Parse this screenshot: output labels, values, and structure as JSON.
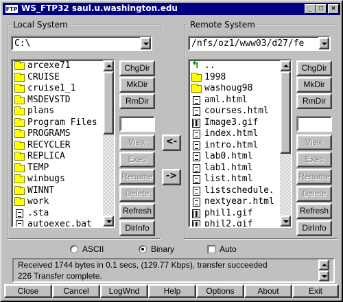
{
  "window": {
    "app_icon_text": "FTP",
    "title": "WS_FTP32 saul.u.washington.edu"
  },
  "local": {
    "group_title": "Local System",
    "path": "C:\\",
    "items": [
      {
        "name": "arcexe71",
        "type": "folder"
      },
      {
        "name": "CRUISE",
        "type": "folder"
      },
      {
        "name": "cruise1_1",
        "type": "folder"
      },
      {
        "name": "MSDEVSTD",
        "type": "folder"
      },
      {
        "name": "plans",
        "type": "folder"
      },
      {
        "name": "Program Files",
        "type": "folder"
      },
      {
        "name": "PROGRAMS",
        "type": "folder"
      },
      {
        "name": "RECYCLER",
        "type": "folder"
      },
      {
        "name": "REPLICA",
        "type": "folder"
      },
      {
        "name": "TEMP",
        "type": "folder"
      },
      {
        "name": "winbugs",
        "type": "folder"
      },
      {
        "name": "WINNT",
        "type": "folder"
      },
      {
        "name": "work",
        "type": "folder"
      },
      {
        "name": ".sta",
        "type": "file"
      },
      {
        "name": "autoexec.bat",
        "type": "file"
      }
    ],
    "buttons": {
      "chgdir": "ChgDir",
      "mkdir": "MkDir",
      "rmdir": "RmDir",
      "view": "View",
      "exec": "Exec",
      "rename": "Rename",
      "delete": "Delete",
      "refresh": "Refresh",
      "dirinfo": "DirInfo"
    }
  },
  "remote": {
    "group_title": "Remote System",
    "path": "/nfs/oz1/www03/d27/fe",
    "items": [
      {
        "name": "..",
        "type": "up"
      },
      {
        "name": "1998",
        "type": "folder"
      },
      {
        "name": "washoug98",
        "type": "folder"
      },
      {
        "name": "aml.html",
        "type": "file"
      },
      {
        "name": "courses.html",
        "type": "file"
      },
      {
        "name": "Image3.gif",
        "type": "image"
      },
      {
        "name": "index.html",
        "type": "file"
      },
      {
        "name": "intro.html",
        "type": "file"
      },
      {
        "name": "lab0.html",
        "type": "file"
      },
      {
        "name": "lab1.html",
        "type": "file"
      },
      {
        "name": "list.html",
        "type": "file"
      },
      {
        "name": "listschedule.",
        "type": "file"
      },
      {
        "name": "nextyear.html",
        "type": "file"
      },
      {
        "name": "phil1.gif",
        "type": "image"
      },
      {
        "name": "phil2.gif",
        "type": "image"
      }
    ],
    "buttons": {
      "chgdir": "ChgDir",
      "mkdir": "MkDir",
      "rmdir": "RmDir",
      "view": "View",
      "exec": "Exec",
      "rename": "Rename",
      "delete": "Delete",
      "refresh": "Refresh",
      "dirinfo": "DirInfo"
    }
  },
  "transfer": {
    "to_local": "<-",
    "to_remote": "->"
  },
  "mode": {
    "ascii": "ASCII",
    "binary": "Binary",
    "auto": "Auto",
    "selected": "Binary"
  },
  "status": {
    "line1": "Received 1744 bytes in 0.1 secs, (129.77 Kbps), transfer succeeded",
    "line2": "226 Transfer complete."
  },
  "bottom": {
    "close": "Close",
    "cancel": "Cancel",
    "logwnd": "LogWnd",
    "help": "Help",
    "options": "Options",
    "about": "About",
    "exit": "Exit"
  },
  "colors": {
    "titlebar": "#000080",
    "face": "#c0c0c0",
    "folder": "#ffff00"
  }
}
